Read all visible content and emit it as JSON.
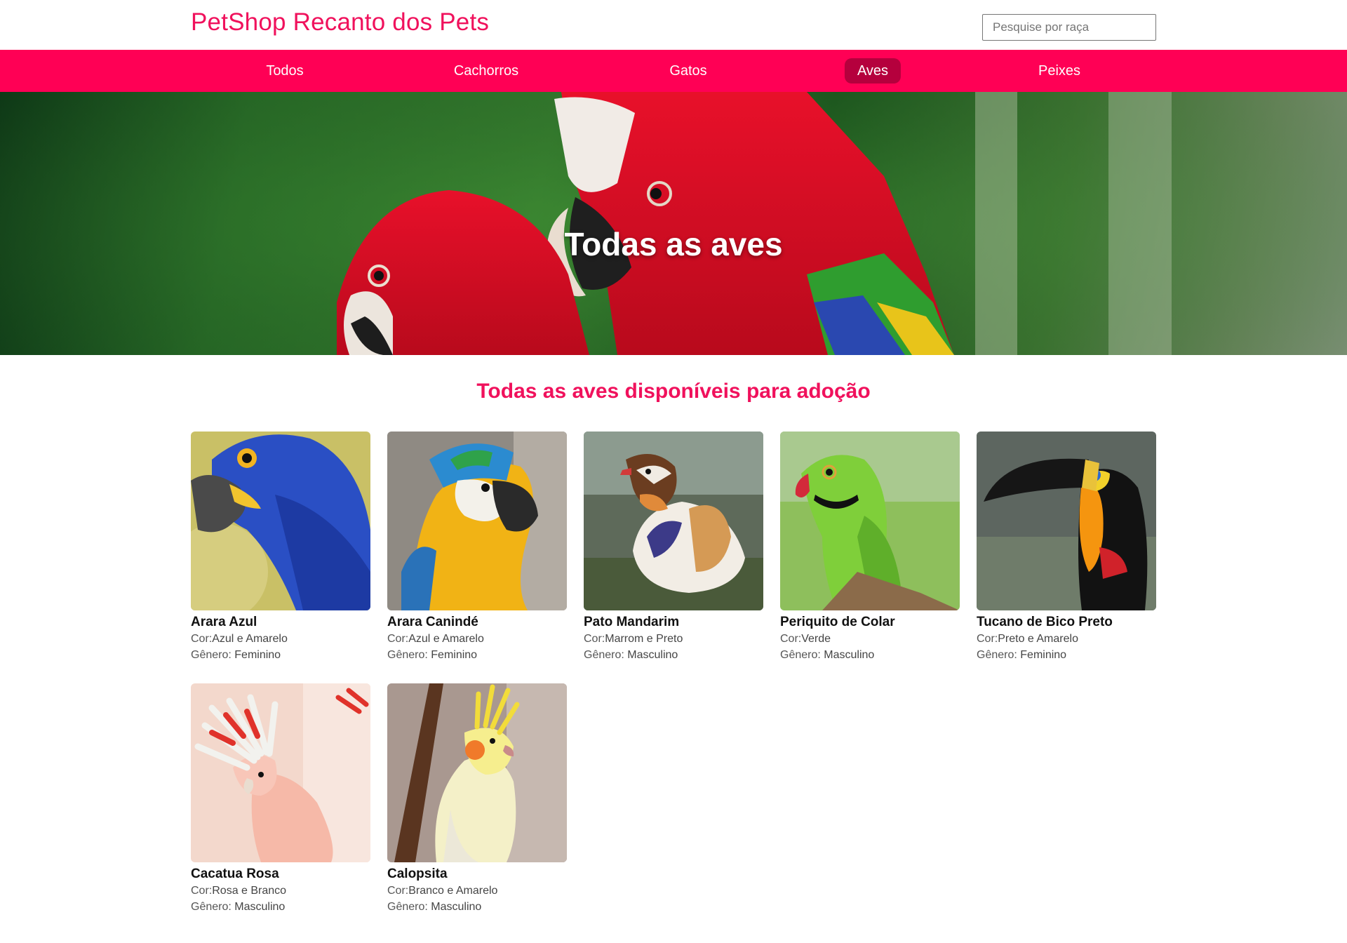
{
  "header": {
    "brand": "PetShop Recanto dos Pets",
    "search_placeholder": "Pesquise por raça"
  },
  "nav": {
    "items": [
      {
        "label": "Todos",
        "active": false
      },
      {
        "label": "Cachorros",
        "active": false
      },
      {
        "label": "Gatos",
        "active": false
      },
      {
        "label": "Aves",
        "active": true
      },
      {
        "label": "Peixes",
        "active": false
      }
    ]
  },
  "hero": {
    "title": "Todas as aves"
  },
  "section": {
    "title": "Todas as aves disponíveis para adoção"
  },
  "birds": [
    {
      "name": "Arara Azul",
      "color_label": "Cor:",
      "color": "Azul e Amarelo",
      "gender_label": "Gênero: ",
      "gender": "Feminino"
    },
    {
      "name": "Arara Canindé",
      "color_label": "Cor:",
      "color": "Azul e Amarelo",
      "gender_label": "Gênero: ",
      "gender": "Feminino"
    },
    {
      "name": "Pato Mandarim",
      "color_label": "Cor:",
      "color": "Marrom e Preto",
      "gender_label": "Gênero: ",
      "gender": "Masculino"
    },
    {
      "name": "Periquito de Colar",
      "color_label": "Cor:",
      "color": "Verde",
      "gender_label": "Gênero: ",
      "gender": "Masculino"
    },
    {
      "name": "Tucano de Bico Preto",
      "color_label": "Cor:",
      "color": "Preto e Amarelo",
      "gender_label": "Gênero: ",
      "gender": "Feminino"
    },
    {
      "name": "Cacatua Rosa",
      "color_label": "Cor:",
      "color": "Rosa e Branco",
      "gender_label": "Gênero: ",
      "gender": "Masculino"
    },
    {
      "name": "Calopsita",
      "color_label": "Cor:",
      "color": "Branco e Amarelo",
      "gender_label": "Gênero: ",
      "gender": "Masculino"
    }
  ],
  "colors": {
    "brand": "#f0115c",
    "nav_bg": "#ff0055",
    "nav_active": "#b5003d"
  }
}
